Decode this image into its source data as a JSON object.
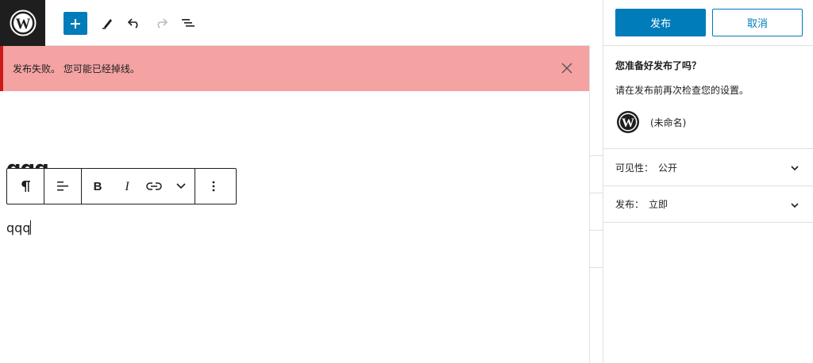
{
  "topbar": {
    "logo_icon": "wordpress-icon",
    "tools": [
      "add-block-icon",
      "edit-pencil-icon",
      "undo-icon",
      "redo-icon",
      "list-view-icon"
    ]
  },
  "notice": {
    "message": "发布失败。 您可能已经掉线。",
    "close_icon": "close-icon",
    "background": "#f4a2a2",
    "border": "#cc1818"
  },
  "editor": {
    "title_fragment": "qqq",
    "paragraph": "qqq",
    "block_toolbar": {
      "groups": [
        [
          "paragraph-icon"
        ],
        [
          "align-left-icon"
        ],
        [
          "bold-icon",
          "italic-icon",
          "link-icon",
          "chevron-down-icon"
        ],
        [
          "more-options-icon"
        ]
      ]
    }
  },
  "sidebar": {
    "publish_label": "发布",
    "cancel_label": "取消",
    "ready_title": "您准备好发布了吗？",
    "check_text": "请在发布前再次检查您的设置。",
    "site_name": "(未命名)",
    "rows": [
      {
        "label": "可见性：",
        "value": "公开"
      },
      {
        "label": "发布：",
        "value": "立即"
      }
    ],
    "accent": "#007cba"
  }
}
